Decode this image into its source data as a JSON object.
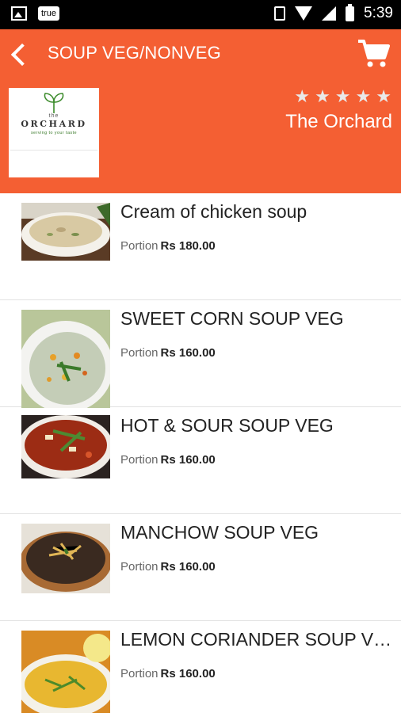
{
  "status_bar": {
    "left_badge": "true",
    "time": "5:39"
  },
  "header": {
    "title": "SOUP VEG/NONVEG",
    "restaurant_name": "The Orchard",
    "rating": 5,
    "stars": [
      "★",
      "★",
      "★",
      "★",
      "★"
    ],
    "logo": {
      "the": "the",
      "name": "ORCHARD",
      "tagline": "serving to your taste"
    },
    "color": "#f45f33"
  },
  "menu_items": [
    {
      "name": "Cream of chicken soup",
      "portion_label": "Portion",
      "price": "Rs 180.00",
      "image": "cream-of-chicken-soup"
    },
    {
      "name": "SWEET CORN SOUP VEG",
      "portion_label": "Portion",
      "price": "Rs 160.00",
      "image": "sweet-corn-soup"
    },
    {
      "name": "HOT & SOUR SOUP VEG",
      "portion_label": "Portion",
      "price": "Rs 160.00",
      "image": "hot-and-sour-soup"
    },
    {
      "name": "MANCHOW SOUP VEG",
      "portion_label": "Portion",
      "price": "Rs 160.00",
      "image": "manchow-soup"
    },
    {
      "name": "LEMON CORIANDER SOUP VEG",
      "portion_label": "Portion",
      "price": "Rs 160.00",
      "image": "lemon-coriander-soup"
    }
  ]
}
